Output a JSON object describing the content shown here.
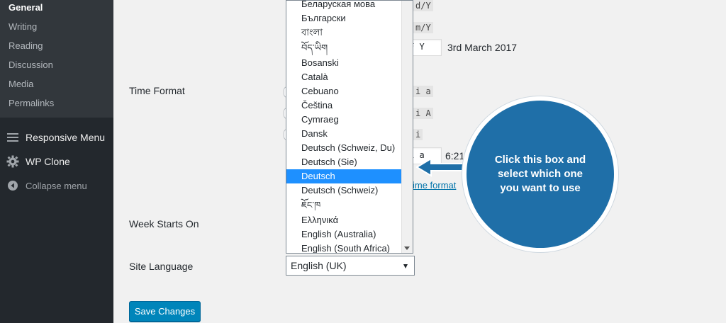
{
  "sidebar": {
    "submenu": [
      "General",
      "Writing",
      "Reading",
      "Discussion",
      "Media",
      "Permalinks"
    ],
    "menu": [
      {
        "label": "Responsive Menu",
        "icon": "hamburger-icon"
      },
      {
        "label": "WP Clone",
        "icon": "gear-icon"
      }
    ],
    "collapse_label": "Collapse menu"
  },
  "settings": {
    "time_format_label": "Time Format",
    "week_starts_label": "Week Starts On",
    "site_language_label": "Site Language",
    "date_formats": [
      "d/Y",
      "m/Y",
      "F Y"
    ],
    "date_preview": "3rd March 2017",
    "time_formats": [
      "i a",
      "i A",
      "i",
      "i a"
    ],
    "time_preview": "6:21",
    "doc_link": "ime format"
  },
  "language_dropdown": {
    "options": [
      "Беларуская мова",
      "Български",
      "বাংলা",
      "བོད་ཡིག",
      "Bosanski",
      "Català",
      "Cebuano",
      "Čeština",
      "Cymraeg",
      "Dansk",
      "Deutsch (Schweiz, Du)",
      "Deutsch (Sie)",
      "Deutsch",
      "Deutsch (Schweiz)",
      "ཇོང་ཁ",
      "Ελληνικά",
      "English (Australia)",
      "English (South Africa)"
    ],
    "highlighted": "Deutsch",
    "selected_value": "English (UK)"
  },
  "save_button_label": "Save Changes",
  "callout_text": "Click this box and select which one you want to use",
  "colors": {
    "sidebar_bg": "#23282d",
    "submenu_bg": "#32373c",
    "highlight": "#1e90ff",
    "button": "#0085ba",
    "callout": "#1f6fa8"
  }
}
